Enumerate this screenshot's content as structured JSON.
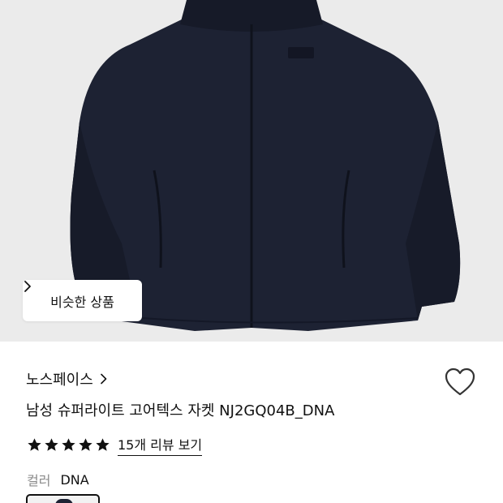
{
  "product_image": {
    "alt": "",
    "background": "#ebebeb",
    "jacket_color": "#1d2233"
  },
  "similar_button": {
    "label": "비슷한 상품"
  },
  "brand": {
    "name": "노스페이스"
  },
  "product": {
    "title": "남성 슈퍼라이트 고어텍스 자켓 NJ2GQ04B_DNA"
  },
  "rating": {
    "stars": 5,
    "max": 5,
    "review_link": "15개 리뷰 보기"
  },
  "color": {
    "label": "컬러",
    "value": "DNA"
  },
  "icons": [
    "chevron-right-icon",
    "heart-icon",
    "star-icon"
  ]
}
